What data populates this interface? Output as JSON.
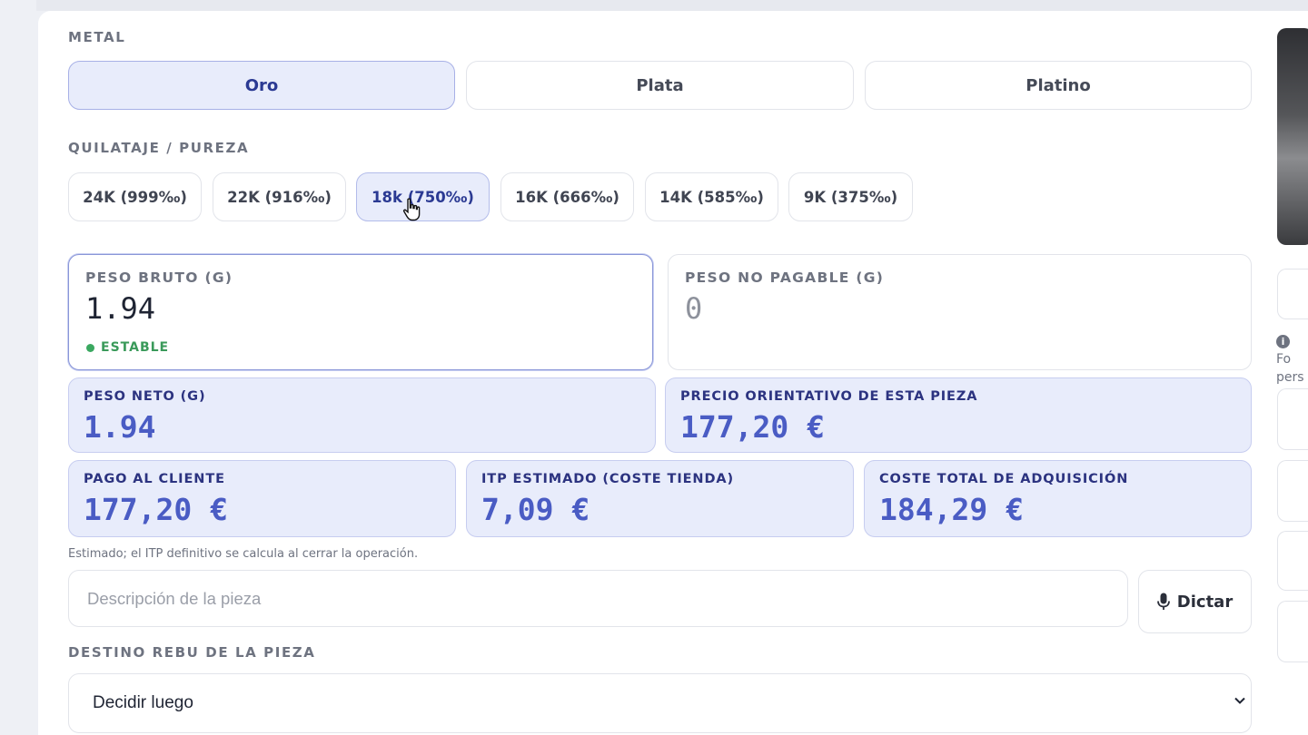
{
  "metal": {
    "label": "METAL",
    "options": [
      "Oro",
      "Plata",
      "Platino"
    ],
    "selected": "Oro"
  },
  "karat": {
    "label": "QUILATAJE / PUREZA",
    "options": [
      "24K (999‰)",
      "22K (916‰)",
      "18k (750‰)",
      "16K (666‰)",
      "14K (585‰)",
      "9K (375‰)"
    ],
    "selected": "18k (750‰)"
  },
  "peso_bruto": {
    "label": "PESO BRUTO (G)",
    "value": "1.94",
    "status": "ESTABLE"
  },
  "peso_no_pagable": {
    "label": "PESO NO PAGABLE (G)",
    "value": "0"
  },
  "peso_neto": {
    "label": "PESO NETO (G)",
    "value": "1.94"
  },
  "precio_orientativo": {
    "label": "PRECIO ORIENTATIVO DE ESTA PIEZA",
    "value": "177,20 €"
  },
  "pago_cliente": {
    "label": "PAGO AL CLIENTE",
    "value": "177,20 €"
  },
  "itp": {
    "label": "ITP ESTIMADO (COSTE TIENDA)",
    "value": "7,09 €"
  },
  "coste_total": {
    "label": "COSTE TOTAL DE ADQUISICIÓN",
    "value": "184,29 €"
  },
  "note": "Estimado; el ITP definitivo se calcula al cerrar la operación.",
  "description": {
    "placeholder": "Descripción de la pieza",
    "value": ""
  },
  "dictar": {
    "label": "Dictar",
    "icon": "microphone-icon"
  },
  "destino": {
    "label": "DESTINO REBU DE LA PIEZA",
    "selected": "Decidir luego"
  },
  "side": {
    "info_text_line1": "Fo",
    "info_text_line2": "pers"
  },
  "colors": {
    "accent": "#4a5cc4",
    "accent_bg": "#e8ecfb",
    "stable": "#3aa860"
  }
}
